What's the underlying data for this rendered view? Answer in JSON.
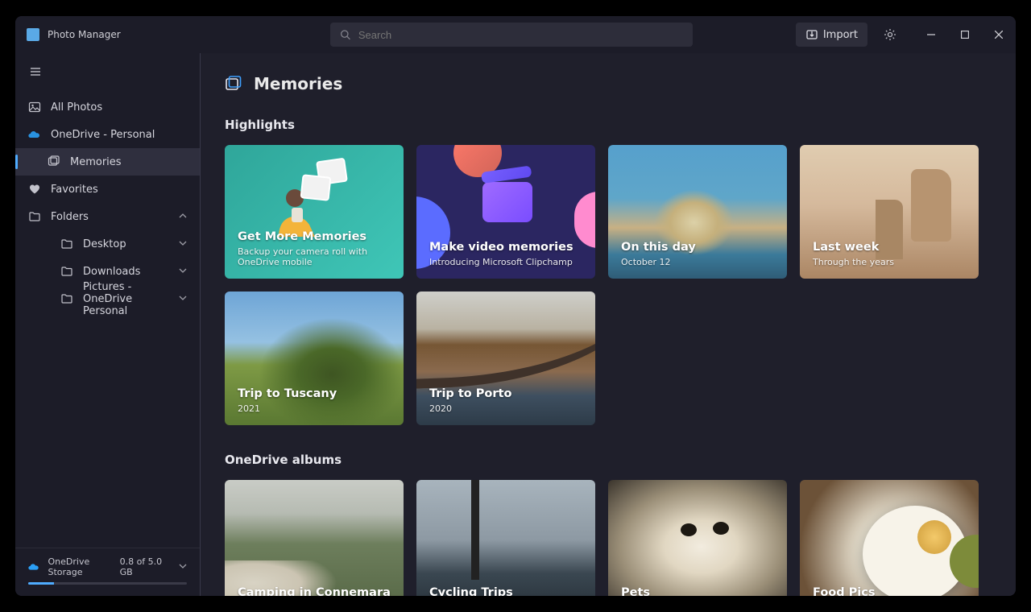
{
  "app": {
    "title": "Photo Manager"
  },
  "search": {
    "placeholder": "Search"
  },
  "import": {
    "label": "Import"
  },
  "sidebar": {
    "items": [
      {
        "key": "all",
        "label": "All Photos"
      },
      {
        "key": "onedrive",
        "label": "OneDrive - Personal"
      },
      {
        "key": "memories",
        "label": "Memories"
      },
      {
        "key": "favorites",
        "label": "Favorites"
      }
    ],
    "folders": {
      "label": "Folders",
      "children": [
        {
          "label": "Desktop"
        },
        {
          "label": "Downloads"
        },
        {
          "label": "Pictures - OneDrive Personal"
        }
      ]
    }
  },
  "storage": {
    "label": "OneDrive Storage",
    "used": "0.8 of 5.0 GB",
    "pct": 16
  },
  "page": {
    "title": "Memories"
  },
  "highlights": {
    "title": "Highlights",
    "cards": [
      {
        "title": "Get More Memories",
        "subtitle": "Backup your camera roll with OneDrive mobile"
      },
      {
        "title": "Make video memories",
        "subtitle": "Introducing Microsoft Clipchamp"
      },
      {
        "title": "On this day",
        "subtitle": "October 12"
      },
      {
        "title": "Last week",
        "subtitle": "Through the years"
      },
      {
        "title": "Trip to Tuscany",
        "subtitle": "2021"
      },
      {
        "title": "Trip to Porto",
        "subtitle": "2020"
      }
    ]
  },
  "albums": {
    "title": "OneDrive albums",
    "cards": [
      {
        "title": "Camping in Connemara"
      },
      {
        "title": "Cycling Trips"
      },
      {
        "title": "Pets"
      },
      {
        "title": "Food Pics"
      }
    ]
  }
}
